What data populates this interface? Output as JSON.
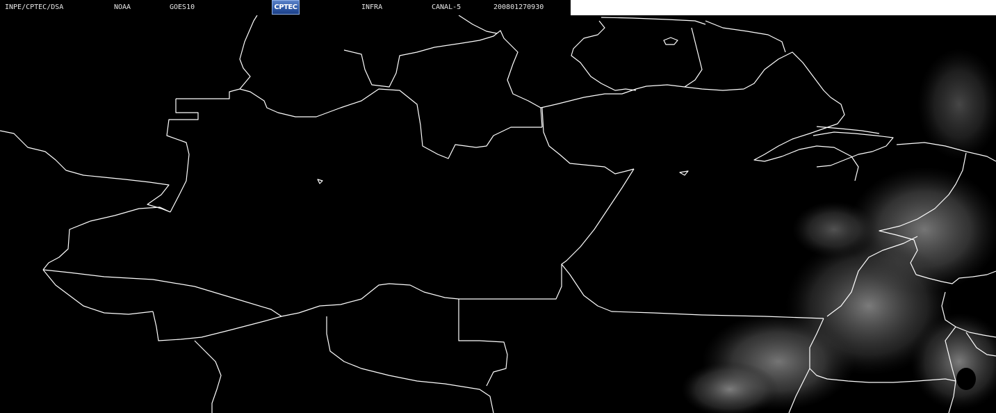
{
  "header": {
    "institution": "INPE/CPTEC/DSA",
    "agency": "NOAA",
    "satellite": "GOES10",
    "logo_text": "CPTEC",
    "product": "INFRA",
    "channel": "CANAL-5",
    "timestamp": "200801270930"
  },
  "colors": {
    "background": "#000000",
    "border_lines": "#ffffff",
    "cloud_gray": "#6e6e6e",
    "header_text": "#e8e8e8",
    "logo_blue": "#2f5aa8"
  }
}
